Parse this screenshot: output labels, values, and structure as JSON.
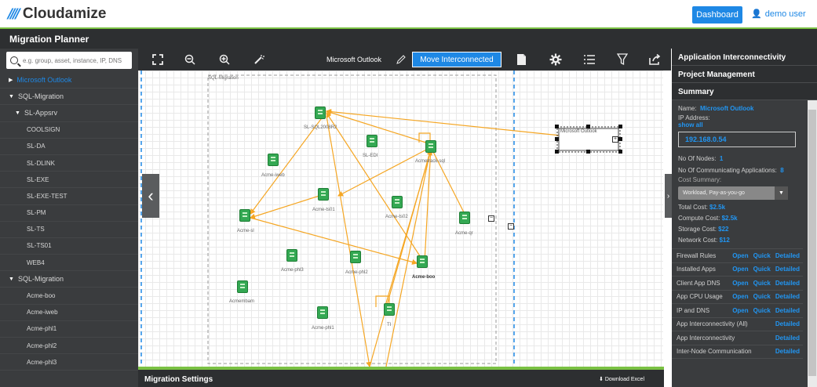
{
  "header": {
    "brand": "Cloudamize",
    "logo_mark": "////",
    "dashboard_label": "Dashboard",
    "user_label": "demo user",
    "user_icon": "user-icon"
  },
  "title_bar": {
    "title": "Migration Planner"
  },
  "sidebar": {
    "search_placeholder": "e.g. group, asset, instance, IP, DNS",
    "items": [
      {
        "label": "Microsoft Outlook",
        "level": 0,
        "arrow": "▶",
        "active": true
      },
      {
        "label": "SQL-Migration",
        "level": 0,
        "arrow": "▼"
      },
      {
        "label": "SL-Appsrv",
        "level": 1,
        "arrow": "▼"
      },
      {
        "label": "COOLSIGN",
        "level": 2
      },
      {
        "label": "SL-DA",
        "level": 2
      },
      {
        "label": "SL-DLINK",
        "level": 2
      },
      {
        "label": "SL-EXE",
        "level": 2
      },
      {
        "label": "SL-EXE-TEST",
        "level": 2
      },
      {
        "label": "SL-PM",
        "level": 2
      },
      {
        "label": "SL-TS",
        "level": 2
      },
      {
        "label": "SL-TS01",
        "level": 2
      },
      {
        "label": "WEB4",
        "level": 2
      },
      {
        "label": "SQL-Migration",
        "level": 0,
        "arrow": "▼"
      },
      {
        "label": "Acme-boo",
        "level": 2
      },
      {
        "label": "Acme-iweb",
        "level": 2
      },
      {
        "label": "Acme-phl1",
        "level": 2
      },
      {
        "label": "Acme-phl2",
        "level": 2
      },
      {
        "label": "Acme-phl3",
        "level": 2
      }
    ]
  },
  "toolbar": {
    "title": "Microsoft Outlook",
    "move_label": "Move Interconnected",
    "icons": [
      "fit-screen-icon",
      "zoom-out-icon",
      "zoom-in-icon",
      "magic-wand-icon",
      "edit-icon",
      "export-file-icon",
      "gear-icon",
      "list-icon",
      "filter-icon",
      "share-icon"
    ]
  },
  "canvas": {
    "group_label": "SQL-Migration",
    "selected_label": "Microsoft Outlook",
    "nodes": [
      {
        "label": "SL-SQL2008R2"
      },
      {
        "label": "SL-EDI"
      },
      {
        "label": "Acmetrack-sql"
      },
      {
        "label": "Acme-iweb"
      },
      {
        "label": "Acme-ts01"
      },
      {
        "label": "Acme-ts02"
      },
      {
        "label": "Acme-sl"
      },
      {
        "label": "Acme-qr"
      },
      {
        "label": "Acme-phl3"
      },
      {
        "label": "Acme-phl2"
      },
      {
        "label": "Acme-boo"
      },
      {
        "label": "Acmembam"
      },
      {
        "label": "Acme-phl1"
      },
      {
        "label": "TI"
      }
    ]
  },
  "bottom": {
    "title": "Migration Settings",
    "download_label": "Download Excel",
    "download_icon": "download-icon"
  },
  "right_panel": {
    "headers": [
      "Application Interconnectivity",
      "Project Management",
      "Summary"
    ],
    "name_label": "Name:",
    "name_value": "Microsoft Outlook",
    "ip_label": "IP Address:",
    "show_all": "show all",
    "ip_value": "192.168.0.54",
    "nodes_label": "No Of Nodes:",
    "nodes_value": "1",
    "comm_label": "No Of Communicating Applications:",
    "comm_value": "8",
    "cost_summary_label": "Cost Summary:",
    "cost_select": "Workload, Pay-as-you-go",
    "total_cost_label": "Total Cost:",
    "total_cost": "$2.5k",
    "compute_cost_label": "Compute Cost:",
    "compute_cost": "$2.5k",
    "storage_cost_label": "Storage Cost:",
    "storage_cost": "$22",
    "network_cost_label": "Network Cost:",
    "network_cost": "$12",
    "rows": [
      {
        "label": "Firewall Rules",
        "links": [
          "Open",
          "Quick",
          "Detailed"
        ]
      },
      {
        "label": "Installed Apps",
        "links": [
          "Open",
          "Quick",
          "Detailed"
        ]
      },
      {
        "label": "Client App DNS",
        "links": [
          "Open",
          "Quick",
          "Detailed"
        ]
      },
      {
        "label": "App CPU Usage",
        "links": [
          "Open",
          "Quick",
          "Detailed"
        ]
      },
      {
        "label": "IP and DNS",
        "links": [
          "Open",
          "Quick",
          "Detailed"
        ]
      },
      {
        "label": "App Interconnectivity (All)",
        "links": [
          "Detailed"
        ]
      },
      {
        "label": "App Interconnectivity",
        "links": [
          "Detailed"
        ]
      },
      {
        "label": "Inter-Node Communication",
        "links": [
          "Detailed"
        ]
      }
    ]
  },
  "colors": {
    "accent": "#1e88e5",
    "green": "#7ac143",
    "dark": "#2d2f31",
    "edge": "#f5a623",
    "node": "#34a853"
  }
}
